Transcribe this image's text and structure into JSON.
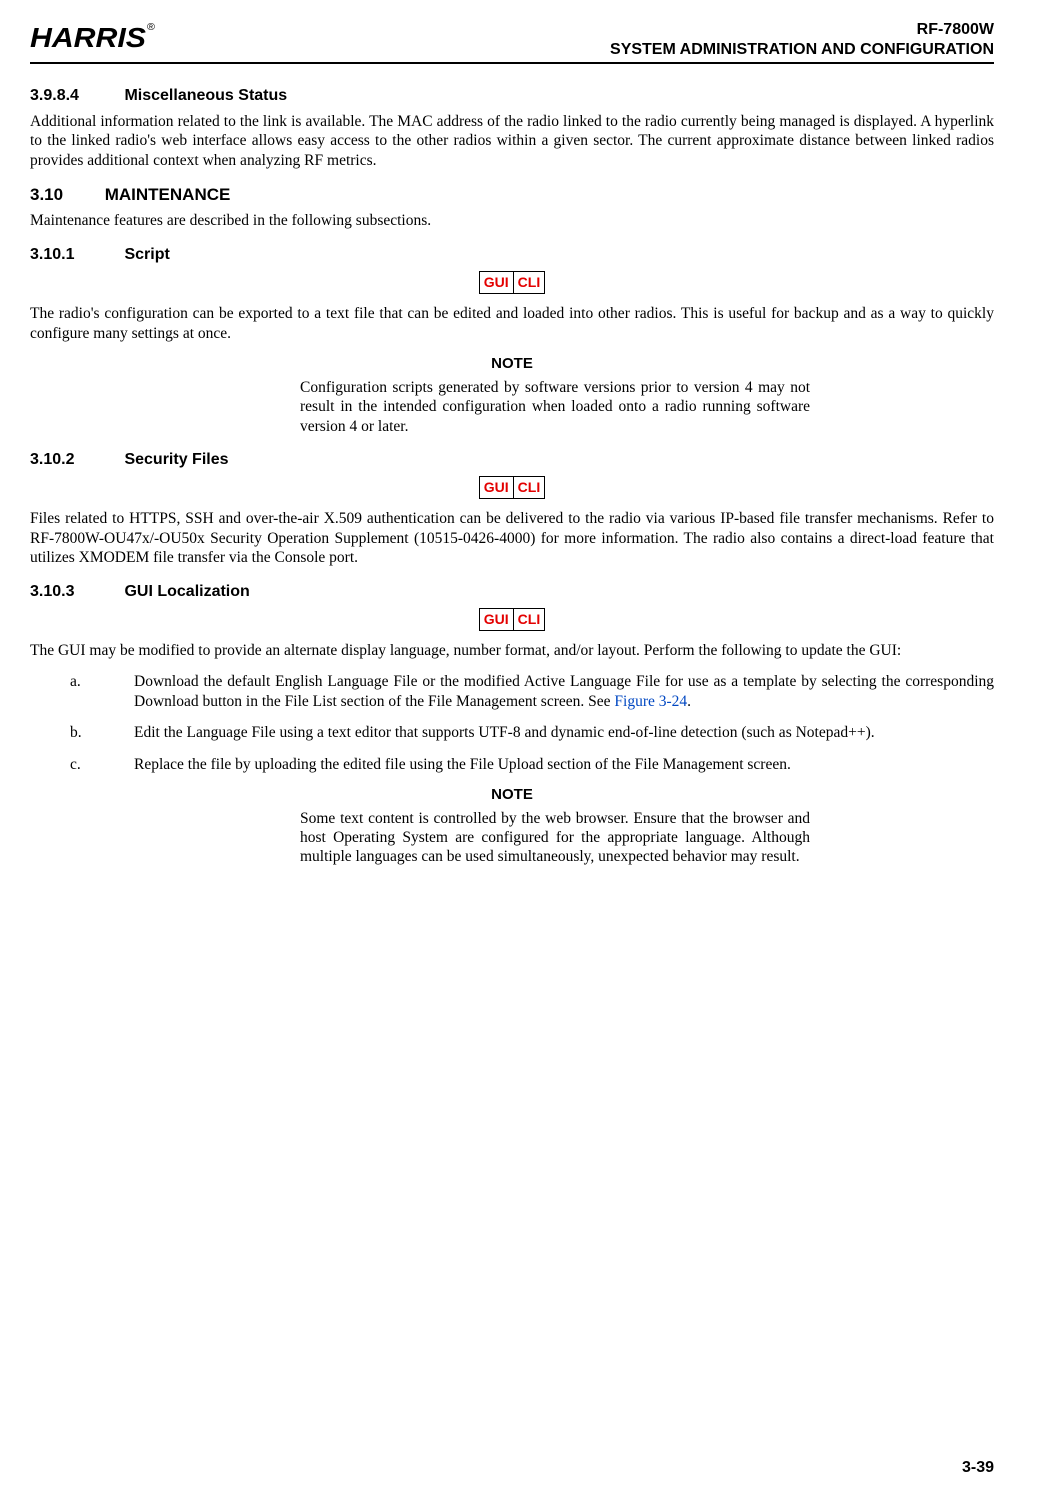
{
  "header": {
    "logo_text": "HARRIS",
    "logo_reg": "®",
    "model": "RF-7800W",
    "title": "SYSTEM ADMINISTRATION AND CONFIGURATION"
  },
  "badges": {
    "gui": "GUI",
    "cli": "CLI"
  },
  "s3984": {
    "num": "3.9.8.4",
    "title": "Miscellaneous Status",
    "body": "Additional information related to the link is available. The MAC address of the radio linked to the radio currently being managed is displayed. A hyperlink to the linked radio's web interface allows easy access to the other radios within a given sector. The current approximate distance between linked radios provides additional context when analyzing RF metrics."
  },
  "s310": {
    "num": "3.10",
    "title": "MAINTENANCE",
    "body": "Maintenance features are described in the following subsections."
  },
  "s3101": {
    "num": "3.10.1",
    "title": "Script",
    "body": "The radio's configuration can be exported to a text file that can be edited and loaded into other radios. This is useful for backup and as a way to quickly configure many settings at once.",
    "note_heading": "NOTE",
    "note_body": "Configuration scripts generated by software versions prior to version 4 may not result in the intended configuration when loaded onto a radio running software version 4 or later."
  },
  "s3102": {
    "num": "3.10.2",
    "title": "Security Files",
    "body": "Files related to HTTPS, SSH and over-the-air X.509 authentication can be delivered to the radio via various IP-based file transfer mechanisms. Refer to RF-7800W-OU47x/-OU50x Security Operation Supplement (10515-0426-4000) for more information. The radio also contains a direct-load feature that utilizes XMODEM file transfer via the Console port."
  },
  "s3103": {
    "num": "3.10.3",
    "title": "GUI Localization",
    "body": "The GUI may be modified to provide an alternate display language, number format, and/or layout. Perform the following to update the GUI:",
    "steps": {
      "a": {
        "marker": "a.",
        "pre": "Download the default English Language File or the modified Active Language File for use as a template by selecting the corresponding Download button in the File List section of the File Management screen. See ",
        "figref": "Figure 3-24",
        "post": "."
      },
      "b": {
        "marker": "b.",
        "text": "Edit the Language File using a text editor that supports UTF-8 and dynamic end-of-line detection (such as Notepad++)."
      },
      "c": {
        "marker": "c.",
        "text": "Replace the file by uploading the edited file using the File Upload section of the File Management screen."
      }
    },
    "note_heading": "NOTE",
    "note_body": "Some text content is controlled by the web browser. Ensure that the browser and host Operating System are configured for the appropriate language. Although multiple languages can be used simultaneously, unexpected behavior may result."
  },
  "footer": {
    "page": "3-39"
  }
}
